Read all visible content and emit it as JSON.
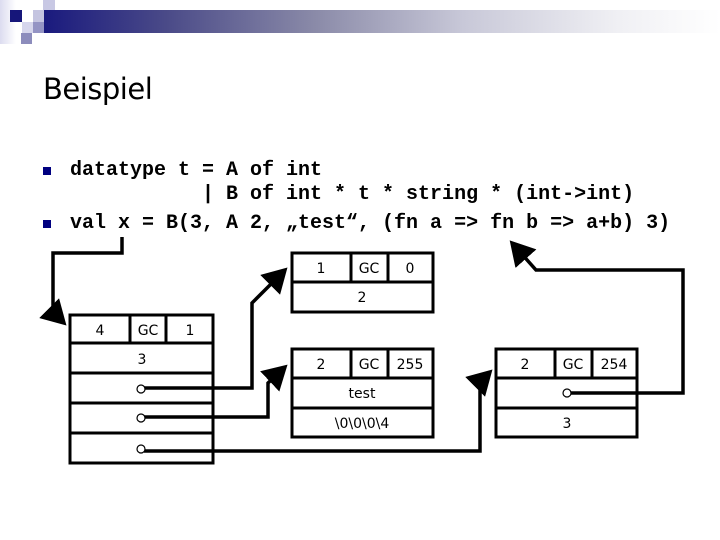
{
  "slide": {
    "title": "Beispiel",
    "bullets": [
      {
        "lines": [
          "datatype t = A of int",
          "           | B of int * t * string * (int->int)"
        ]
      },
      {
        "lines": [
          "val x = B(3, A 2, „test“, (fn a => fn b => a+b) 3)"
        ]
      }
    ]
  },
  "diagram": {
    "blocks": [
      {
        "id": "block-b",
        "header": [
          "4",
          "GC",
          "1"
        ],
        "rows": [
          "3",
          "o",
          "o",
          "o"
        ]
      },
      {
        "id": "block-a",
        "header": [
          "1",
          "GC",
          "0"
        ],
        "rows": [
          "2"
        ]
      },
      {
        "id": "block-string",
        "header": [
          "2",
          "GC",
          "255"
        ],
        "rows": [
          "test",
          "\\0\\0\\0\\4"
        ]
      },
      {
        "id": "block-closure",
        "header": [
          "2",
          "GC",
          "254"
        ],
        "rows": [
          "o",
          "3"
        ]
      }
    ],
    "pointers": [
      {
        "from": "val-x",
        "to": "block-b"
      },
      {
        "from": "block-b.row2",
        "to": "block-a"
      },
      {
        "from": "block-b.row3",
        "to": "block-string"
      },
      {
        "from": "block-b.row4",
        "to": "block-closure"
      },
      {
        "from": "block-closure.row1",
        "to": "fn-b-code"
      }
    ]
  },
  "colors": {
    "accent": "#1a1a7e",
    "bullet": "#000080",
    "ink": "#000000"
  }
}
